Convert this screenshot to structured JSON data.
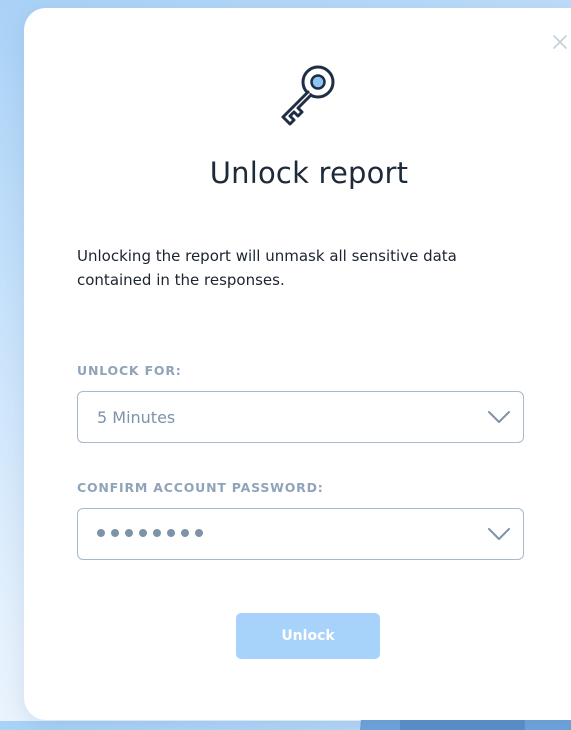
{
  "dialog": {
    "title": "Unlock report",
    "description": "Unlocking the report will unmask all sensitive data contained in the responses.",
    "close_icon": "close-icon",
    "header_icon": "key-icon"
  },
  "unlock_for": {
    "label": "UNLOCK FOR:",
    "value": "5 Minutes",
    "icon": "chevron-down-icon"
  },
  "password": {
    "label": "CONFIRM ACCOUNT PASSWORD:",
    "masked_length": 8,
    "icon": "chevron-down-icon"
  },
  "actions": {
    "unlock_label": "Unlock"
  },
  "colors": {
    "accent": "#a7d3fb",
    "title_text": "#1e2a3a",
    "label_text": "#8fa4b8",
    "field_border": "#a8b9cc"
  }
}
